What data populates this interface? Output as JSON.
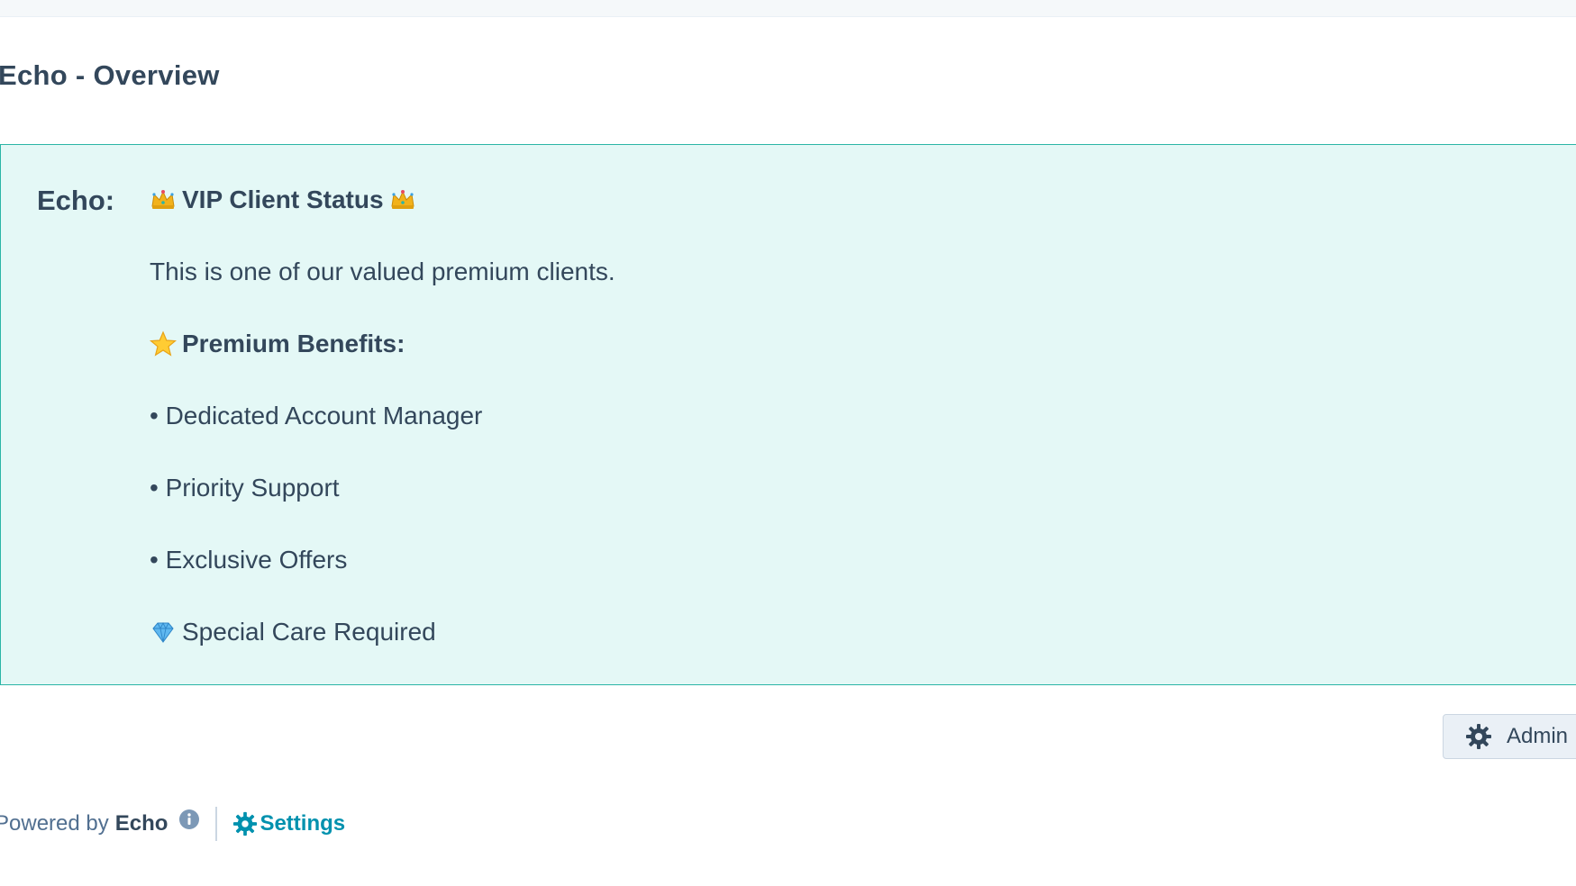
{
  "header": {
    "title": "Echo - Overview"
  },
  "card": {
    "label": "Echo:",
    "headline": "VIP Client Status",
    "headline_icons": [
      "crown-icon",
      "crown-icon"
    ],
    "intro": "This is one of our valued premium clients.",
    "benefits_heading": "Premium Benefits:",
    "benefits_icon": "star-icon",
    "benefits": [
      "• Dedicated Account Manager",
      "• Priority Support",
      "• Exclusive Offers"
    ],
    "note": "Special Care Required",
    "note_icon": "gem-icon",
    "colors": {
      "background": "#e4f8f6",
      "border": "#2bb5a6",
      "text": "#33475b"
    }
  },
  "actions": {
    "admin_label": "Admin",
    "admin_icon": "gear-icon"
  },
  "footer": {
    "powered_prefix": "Powered by",
    "brand": "Echo",
    "info_icon": "info-icon",
    "settings_label": "Settings",
    "settings_icon": "gear-icon",
    "link_color": "#0091ae"
  }
}
